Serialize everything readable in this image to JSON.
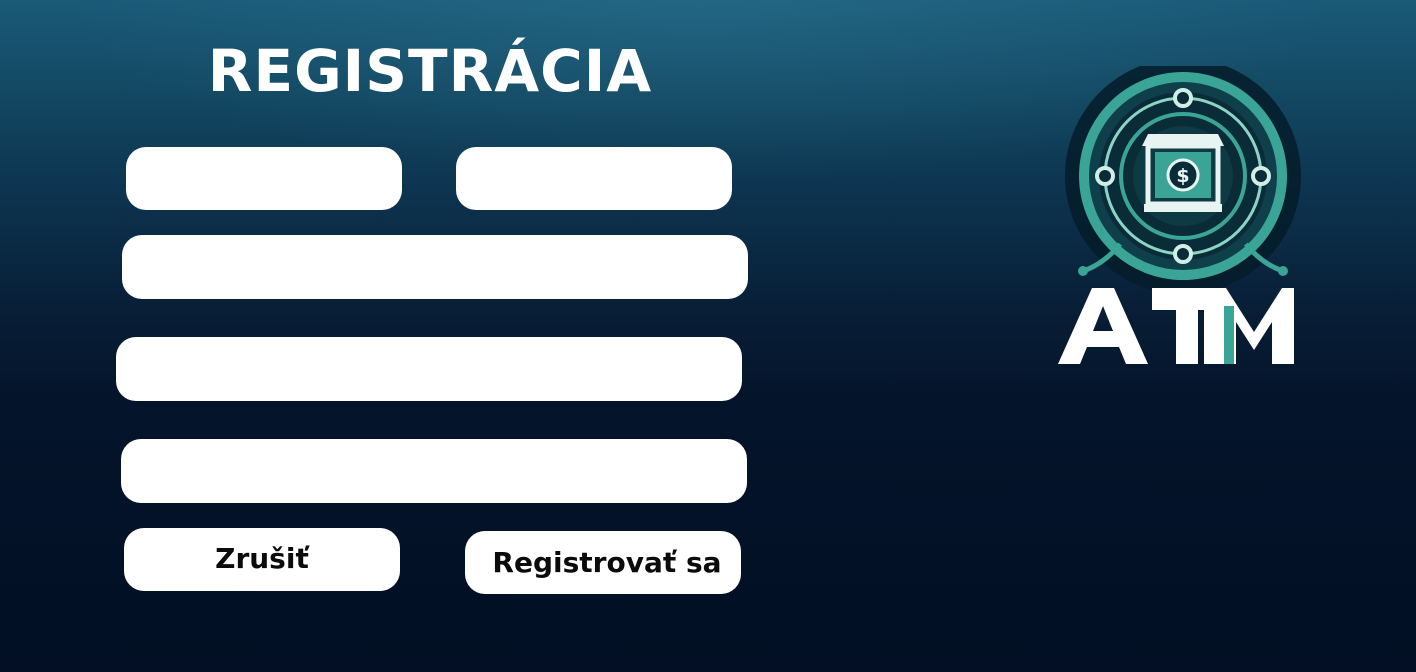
{
  "form": {
    "title": "REGISTRÁCIA",
    "fields": [
      {
        "value": "",
        "placeholder": ""
      },
      {
        "value": "",
        "placeholder": ""
      },
      {
        "value": "",
        "placeholder": ""
      },
      {
        "value": "",
        "placeholder": ""
      },
      {
        "value": "",
        "placeholder": ""
      }
    ],
    "cancel_label": "Zrušiť",
    "register_label": "Registrovať sa"
  },
  "logo": {
    "text": "ATM",
    "icon": "bank-dollar-emblem-icon"
  },
  "colors": {
    "background_top": "#1a5a78",
    "background_bottom": "#020f24",
    "accent_teal": "#3aa596",
    "field_bg": "#ffffff"
  }
}
